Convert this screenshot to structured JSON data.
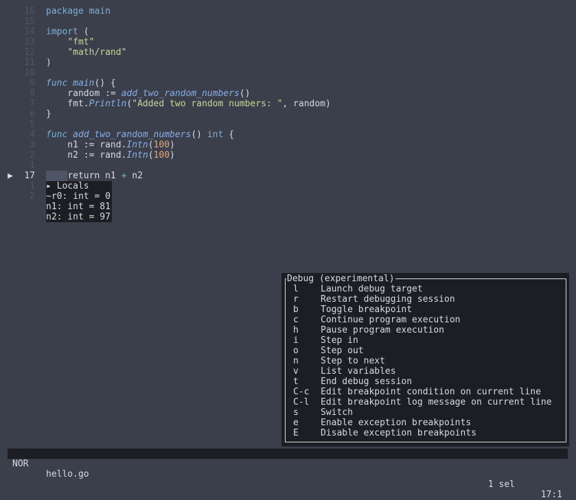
{
  "editor": {
    "debug_marker": "▶",
    "lines": [
      {
        "n": "16",
        "tokens": [
          [
            "kw",
            "package"
          ],
          [
            "op",
            " "
          ],
          [
            "kw",
            "main"
          ]
        ]
      },
      {
        "n": "15",
        "tokens": []
      },
      {
        "n": "14",
        "tokens": [
          [
            "kw",
            "import"
          ],
          [
            "op",
            " ("
          ]
        ]
      },
      {
        "n": "13",
        "tokens": [
          [
            "op",
            "    "
          ],
          [
            "str",
            "\"fmt\""
          ]
        ]
      },
      {
        "n": "12",
        "tokens": [
          [
            "op",
            "    "
          ],
          [
            "str",
            "\"math/rand\""
          ]
        ]
      },
      {
        "n": "11",
        "tokens": [
          [
            "op",
            ")"
          ]
        ]
      },
      {
        "n": "10",
        "tokens": []
      },
      {
        "n": "9",
        "tokens": [
          [
            "kwi",
            "func"
          ],
          [
            "op",
            " "
          ],
          [
            "fn",
            "main"
          ],
          [
            "op",
            "() {"
          ]
        ]
      },
      {
        "n": "8",
        "tokens": [
          [
            "op",
            "    random := "
          ],
          [
            "fn",
            "add_two_random_numbers"
          ],
          [
            "op",
            "()"
          ]
        ]
      },
      {
        "n": "7",
        "tokens": [
          [
            "op",
            "    fmt."
          ],
          [
            "fn",
            "Println"
          ],
          [
            "op",
            "("
          ],
          [
            "str",
            "\"Added two random numbers: \""
          ],
          [
            "op",
            ", random)"
          ]
        ]
      },
      {
        "n": "6",
        "tokens": [
          [
            "op",
            "}"
          ]
        ]
      },
      {
        "n": "5",
        "tokens": []
      },
      {
        "n": "4",
        "tokens": [
          [
            "kwi",
            "func"
          ],
          [
            "op",
            " "
          ],
          [
            "fn",
            "add_two_random_numbers"
          ],
          [
            "op",
            "() "
          ],
          [
            "kw",
            "int"
          ],
          [
            "op",
            " {"
          ]
        ]
      },
      {
        "n": "3",
        "tokens": [
          [
            "op",
            "    n1 := rand."
          ],
          [
            "fn",
            "Intn"
          ],
          [
            "op",
            "("
          ],
          [
            "num",
            "100"
          ],
          [
            "op",
            ")"
          ]
        ]
      },
      {
        "n": "2",
        "tokens": [
          [
            "op",
            "    n2 := rand."
          ],
          [
            "fn",
            "Intn"
          ],
          [
            "op",
            "("
          ],
          [
            "num",
            "100"
          ],
          [
            "op",
            ")"
          ]
        ]
      },
      {
        "n": "1",
        "tokens": []
      },
      {
        "n": "17",
        "current": true,
        "tokens": [
          [
            "op",
            "    return n1 "
          ],
          [
            "kw",
            "+"
          ],
          [
            "op",
            " n2"
          ]
        ]
      },
      {
        "n": "1",
        "tokens": []
      },
      {
        "n": "2",
        "tokens": []
      }
    ]
  },
  "locals": {
    "header": "▸ Locals",
    "items": [
      "~r0: int = 0",
      "n1: int = 81",
      "n2: int = 97"
    ]
  },
  "debug_menu": {
    "title": "Debug (experimental)",
    "items": [
      {
        "key": "l",
        "label": "Launch debug target"
      },
      {
        "key": "r",
        "label": "Restart debugging session"
      },
      {
        "key": "b",
        "label": "Toggle breakpoint"
      },
      {
        "key": "c",
        "label": "Continue program execution"
      },
      {
        "key": "h",
        "label": "Pause program execution"
      },
      {
        "key": "i",
        "label": "Step in"
      },
      {
        "key": "o",
        "label": "Step out"
      },
      {
        "key": "n",
        "label": "Step to next"
      },
      {
        "key": "v",
        "label": "List variables"
      },
      {
        "key": "t",
        "label": "End debug session"
      },
      {
        "key": "C-c",
        "label": "Edit breakpoint condition on current line"
      },
      {
        "key": "C-l",
        "label": "Edit breakpoint log message on current line"
      },
      {
        "key": "s",
        "label": "Switch"
      },
      {
        "key": "e",
        "label": "Enable exception breakpoints"
      },
      {
        "key": "E",
        "label": "Disable exception breakpoints"
      }
    ]
  },
  "statusbar": {
    "mode": "NOR",
    "filename": "hello.go",
    "selection": "1 sel",
    "position": "17:1"
  }
}
